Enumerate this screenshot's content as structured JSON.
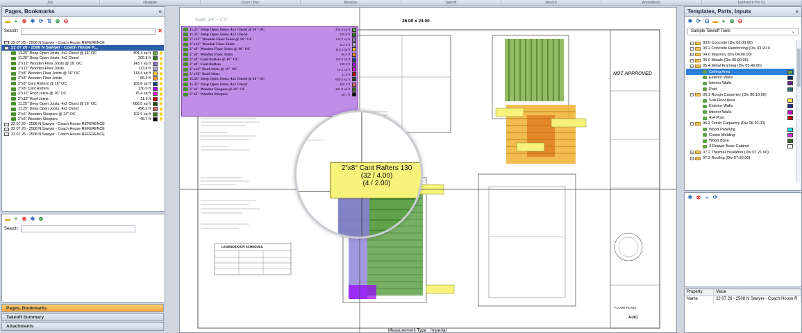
{
  "ribbon": [
    "Job",
    "Navigate",
    "Zoom / Pan",
    "Measure",
    "Takeoff",
    "Record",
    "Annotations",
    "Earthwork Pro V2"
  ],
  "left_panel": {
    "title": "Pages, Bookmarks",
    "collapse_glyph": "«",
    "search_label": "Search:",
    "search_value": "",
    "rows": [
      {
        "label": "22 07 26 - 2508 N Sawyer - Coach House REFERENCE",
        "qty": "",
        "color": "",
        "indent": 0
      },
      {
        "label": "22 07 26 - 2508 N Sawyer - Coach House R...",
        "qty": "",
        "color": "",
        "indent": 0,
        "selected": true
      },
      {
        "label": "11.25\" Deep Open Joists, 4x2 Chord @ 16\" OC",
        "qty": "404.4 sq ft",
        "color": "#6aa84f",
        "indent": 1
      },
      {
        "label": "11.25\" Deep Open Joists, 4x2 Chord",
        "qty": "205.8 ft",
        "color": "#38761d",
        "indent": 1
      },
      {
        "label": "2\"x12\" Wooden Floor Joists @ 16\" OC",
        "qty": "143.7 sq ft",
        "color": "#8e7cc3",
        "indent": 1
      },
      {
        "label": "2\"x12\" Wooden Floor Joists",
        "qty": "113.8 ft",
        "color": "#b4a7d6",
        "indent": 1
      },
      {
        "label": "2\"x8\" Wooden Floor Joists @ 16\" OC",
        "qty": "113.4 sq ft",
        "color": "#f1c232",
        "indent": 1
      },
      {
        "label": "2\"x8\" Wooden Floor Joists",
        "qty": "86.6 ft",
        "color": "#e69138",
        "indent": 1
      },
      {
        "label": "2\"x8\" Cant Rafters @ 16\" OC",
        "qty": "169.6 sq ft",
        "color": "#1c4587",
        "indent": 1
      },
      {
        "label": "2\"x8\" Cant Rafters",
        "qty": "130.0 ft",
        "color": "#9900ff",
        "indent": 1
      },
      {
        "label": "2\"x12\" Roof Joists @ 16\" OC",
        "qty": "15.4 sq ft",
        "color": "#ff00ff",
        "indent": 1
      },
      {
        "label": "2\"x12\" Roof Joists",
        "qty": "11.9 ft",
        "color": "#cc0000",
        "indent": 1
      },
      {
        "label": "11.25\" Deep Open Joists, 4x2 Chord @ 16\" OC",
        "qty": "668.5 sq ft",
        "color": "#274e13",
        "indent": 1
      },
      {
        "label": "11.25\" Deep Open Joists, 4x2 Chord",
        "qty": "496.2 ft",
        "color": "#e06666",
        "indent": 1
      },
      {
        "label": "2\"x6\" Wooden Sleepers @ 24\" OC",
        "qty": "102.9 sq ft",
        "color": "#38761d",
        "indent": 1
      },
      {
        "label": "2\"x6\" Wooden Sleepers",
        "qty": "48.7 ft",
        "color": "#000000",
        "indent": 1
      },
      {
        "label": "22 07 26 - 2508 N Sawyer - Coach House REFERENCE",
        "qty": "",
        "color": "",
        "indent": 0
      },
      {
        "label": "22 07 26 - 2508 N Sawyer - Coach House REFERENCE",
        "qty": "",
        "color": "",
        "indent": 0
      },
      {
        "label": "22 07 26 - 2508 N Sawyer - Coach House REFERENCE",
        "qty": "",
        "color": "",
        "indent": 0
      }
    ],
    "lower_search_label": "Search:",
    "accordion": [
      "Pages, Bookmarks",
      "Takeoff Summary",
      "Attachments"
    ]
  },
  "canvas": {
    "scale_text": "Scale: 1/4\" = 1'-0\"",
    "sheet_size": "36.00 x 24.00",
    "measurement_type": "Measurement Type : Imperial",
    "not_approved": "NOT APPROVED",
    "overlay_rows": [
      {
        "label": "11.25\" Deep Open Joists, 4x2 Chord @ 16\" OC",
        "qty": "404.4 sq ft",
        "color": "#6aa84f"
      },
      {
        "label": "11.25\" Deep Open Joists, 4x2 Chord",
        "qty": "295.8 ft",
        "color": "#38761d"
      },
      {
        "label": "2\"x12\" Wooden Floor Joists @ 16\" OC",
        "qty": "143.7 sq ft",
        "color": "#8e7cc3"
      },
      {
        "label": "2\"x12\" Wooden Floor Joists",
        "qty": "113.8 ft",
        "color": "#b4a7d6"
      },
      {
        "label": "2\"x8\" Wooden Floor Joists @ 16\" OC",
        "qty": "113.4 sq ft",
        "color": "#f1c232"
      },
      {
        "label": "2\"x8\" Wooden Floor Joists",
        "qty": "86.6 ft",
        "color": "#e69138"
      },
      {
        "label": "2\"x8\" Cant Rafters @ 16\" OC",
        "qty": "169.6 sq ft",
        "color": "#1c4587"
      },
      {
        "label": "2\"x8\" Cant Rafters",
        "qty": "130.0 ft",
        "color": "#9900ff"
      },
      {
        "label": "2\"x12\" Roof Joists @ 16\" OC",
        "qty": "15.4 sq ft",
        "color": "#ff00ff"
      },
      {
        "label": "2\"x12\" Roof Joists",
        "qty": "11.9 ft",
        "color": "#cc0000"
      },
      {
        "label": "11.25\" Deep Open Joists, 4x2 Chord @ 16\" OC",
        "qty": "668.5 sq ft",
        "color": "#274e13"
      },
      {
        "label": "11.25\" Deep Open Joists, 4x2 Chord",
        "qty": "496.2 ft",
        "color": "#e06666"
      },
      {
        "label": "2\"x6\" Wooden Sleepers @ 24\" OC",
        "qty": "102.9 sq ft",
        "color": "#38761d"
      },
      {
        "label": "2\"x6\" Wooden Sleepers",
        "qty": "48.7 ft",
        "color": "#000000"
      }
    ],
    "zoom_label": {
      "line1": "2\"x8\" Cant Rafters 130",
      "line2": "(32 / 4.00)",
      "line3": "(4 / 2.00)"
    },
    "legend_title": "LEGEND/DOOR SCHEDULE",
    "sheet_title": "FLOOR PLANS",
    "sheet_number": "A-201"
  },
  "right_panel": {
    "title": "Templates, Parts, Inputs",
    "collapse_glyph": "»",
    "dropdown_value": "Sample Takeoff Tools",
    "rows": [
      {
        "label": "03.0 Concrete (Div 03.00.00)",
        "type": "folder",
        "indent": 0
      },
      {
        "label": "03.2 Concrete Reinforcing (Div 03.20.0",
        "type": "folder",
        "indent": 0
      },
      {
        "label": "04.0 Masonry (Div 04.00.00)",
        "type": "folder",
        "indent": 0
      },
      {
        "label": "05.0 Metals (Div 05.00.00)",
        "type": "folder",
        "indent": 0
      },
      {
        "label": "05.4 Metal Framing (Div 05.40.00)",
        "type": "folder",
        "indent": 0
      },
      {
        "label": "Ceiling Area",
        "type": "item",
        "indent": 1,
        "color": "#6aa84f",
        "selected": true
      },
      {
        "label": "Exterior Walls",
        "type": "item",
        "indent": 1,
        "color": "#0b2a6b"
      },
      {
        "label": "Interior Walls",
        "type": "item",
        "indent": 1,
        "color": "#6d1f8a"
      },
      {
        "label": "Post",
        "type": "item",
        "indent": 1,
        "color": "#2a6f6f"
      },
      {
        "label": "06.1 Rough Carpentry (Div 06.10.00)",
        "type": "folder",
        "indent": 0
      },
      {
        "label": "Sub Floor Area",
        "type": "item",
        "indent": 1,
        "color": "#f1e232"
      },
      {
        "label": "Exterior Walls",
        "type": "item",
        "indent": 1,
        "color": "#1c2e87"
      },
      {
        "label": "Interior Walls",
        "type": "item",
        "indent": 1,
        "color": "#c400c4"
      },
      {
        "label": "4x4 Post",
        "type": "item",
        "indent": 1,
        "color": "#cc0000"
      },
      {
        "label": "06.2 Finish Carpentry (Div 06.20.00)",
        "type": "folder",
        "indent": 0
      },
      {
        "label": "Wood Paneling",
        "type": "item",
        "indent": 1,
        "color": "#00e5e5"
      },
      {
        "label": "Crown Molding",
        "type": "item",
        "indent": 1,
        "color": "#e033e0"
      },
      {
        "label": "Wood Base",
        "type": "item",
        "indent": 1,
        "color": "#2f6b20"
      },
      {
        "label": "3 Drawer Base Cabinet",
        "type": "item",
        "indent": 1,
        "color": "#ffffff"
      },
      {
        "label": "07.2 Thermal Insulation (Div 07.21.00)",
        "type": "folder",
        "indent": 0
      },
      {
        "label": "07.3 Roofing (Div 07.30.00)",
        "type": "folder",
        "indent": 0
      }
    ],
    "property_header": [
      "Property",
      "Value"
    ],
    "property_row": [
      "Name",
      "22 07 26 - 2508 N Sawyer - Coach House R"
    ]
  }
}
